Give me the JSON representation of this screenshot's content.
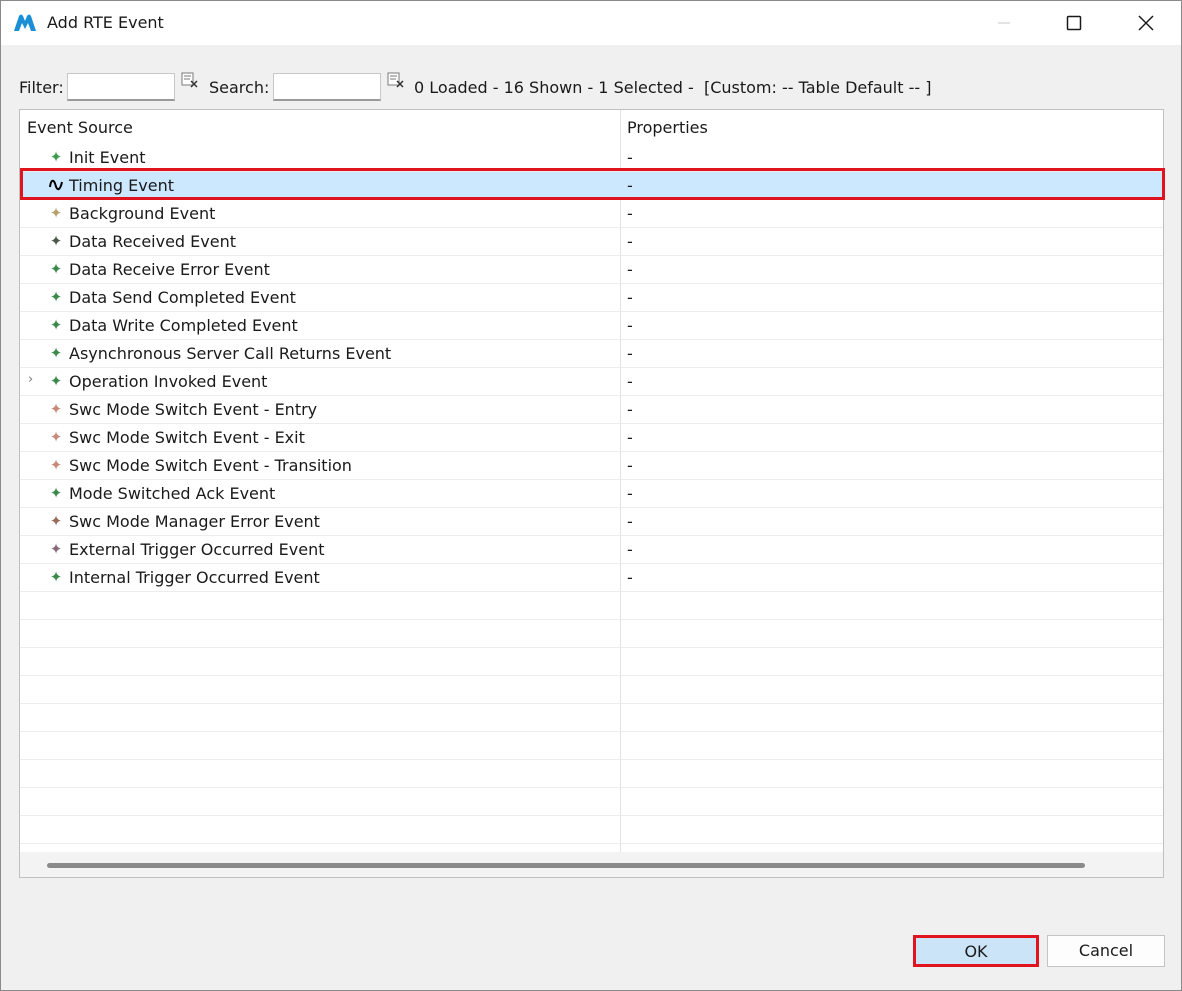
{
  "window": {
    "title": "Add RTE Event",
    "logo_icon": "vector-logo-icon",
    "controls": [
      "minimize-icon",
      "maximize-icon",
      "close-icon"
    ]
  },
  "toolbar": {
    "filter_label": "Filter:",
    "filter_value": "",
    "search_label": "Search:",
    "search_value": "",
    "clear_icon": "clear-filter-icon",
    "status": "0 Loaded - 16 Shown - 1 Selected -  [Custom: -- Table Default -- ]"
  },
  "table": {
    "columns": [
      "Event Source",
      "Properties"
    ],
    "rows": [
      {
        "name": "Init Event",
        "props": "-",
        "icon": "event-icon",
        "color": "#3e9a4c",
        "selected": false
      },
      {
        "name": "Timing Event",
        "props": "-",
        "icon": "timing-wave-icon",
        "color": "#000000",
        "selected": true
      },
      {
        "name": "Background Event",
        "props": "-",
        "icon": "event-icon",
        "color": "#b7a06a",
        "selected": false
      },
      {
        "name": "Data Received Event",
        "props": "-",
        "icon": "event-icon",
        "color": "#4a5a4a",
        "selected": false
      },
      {
        "name": "Data Receive Error Event",
        "props": "-",
        "icon": "event-icon",
        "color": "#3a8a4a",
        "selected": false
      },
      {
        "name": "Data Send Completed Event",
        "props": "-",
        "icon": "event-icon",
        "color": "#3a8a4a",
        "selected": false
      },
      {
        "name": "Data Write Completed Event",
        "props": "-",
        "icon": "event-icon",
        "color": "#3a8a4a",
        "selected": false
      },
      {
        "name": "Asynchronous Server Call Returns Event",
        "props": "-",
        "icon": "event-icon",
        "color": "#3a8a4a",
        "selected": false
      },
      {
        "name": "Operation Invoked Event",
        "props": "-",
        "icon": "event-icon",
        "color": "#3a8a4a",
        "selected": false,
        "expandable": true
      },
      {
        "name": "Swc Mode Switch Event - Entry",
        "props": "-",
        "icon": "event-icon",
        "color": "#c98a7a",
        "selected": false
      },
      {
        "name": "Swc Mode Switch Event - Exit",
        "props": "-",
        "icon": "event-icon",
        "color": "#c98a7a",
        "selected": false
      },
      {
        "name": "Swc Mode Switch Event - Transition",
        "props": "-",
        "icon": "event-icon",
        "color": "#c98a7a",
        "selected": false
      },
      {
        "name": "Mode Switched Ack Event",
        "props": "-",
        "icon": "event-icon",
        "color": "#3a8a4a",
        "selected": false
      },
      {
        "name": "Swc Mode Manager Error Event",
        "props": "-",
        "icon": "event-icon",
        "color": "#9a6a5a",
        "selected": false
      },
      {
        "name": "External Trigger Occurred Event",
        "props": "-",
        "icon": "event-icon",
        "color": "#8a6a7a",
        "selected": false
      },
      {
        "name": "Internal Trigger Occurred Event",
        "props": "-",
        "icon": "event-icon",
        "color": "#3a8a4a",
        "selected": false
      }
    ],
    "expander_icon": "chevron-right-icon"
  },
  "buttons": {
    "ok": "OK",
    "cancel": "Cancel"
  },
  "colors": {
    "selection": "#cce8ff",
    "highlight_border": "#e0141e",
    "ok_button_bg": "#cce4f7"
  }
}
